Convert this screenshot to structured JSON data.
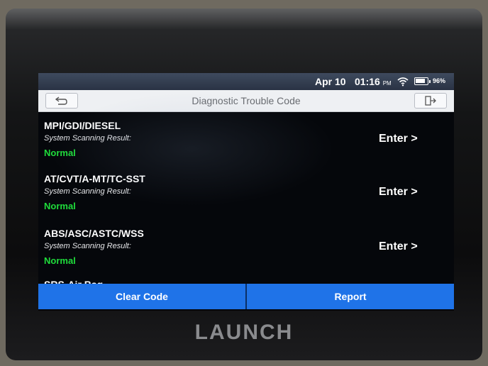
{
  "status_bar": {
    "date": "Apr 10",
    "time": "01:16",
    "ampm": "PM",
    "battery": "96%",
    "battery_level": 0.96
  },
  "header": {
    "title": "Diagnostic Trouble Code"
  },
  "systems": [
    {
      "name": "MPI/GDI/DIESEL",
      "label": "System Scanning Result:",
      "status": "Normal",
      "enter": "Enter >"
    },
    {
      "name": "AT/CVT/A-MT/TC-SST",
      "label": "System Scanning Result:",
      "status": "Normal",
      "enter": "Enter >"
    },
    {
      "name": "ABS/ASC/ASTC/WSS",
      "label": "System Scanning Result:",
      "status": "Normal",
      "enter": "Enter >"
    }
  ],
  "partial_row": {
    "name": "SRS-Air Bag"
  },
  "footer": {
    "clear_code": "Clear Code",
    "report": "Report"
  },
  "device": {
    "brand": "LAUNCH"
  },
  "icons": {
    "back": "back-arrow-icon",
    "exit": "exit-icon",
    "wifi": "wifi-icon",
    "battery": "battery-icon"
  },
  "colors": {
    "status_normal": "#1fdc3b",
    "button_blue": "#1f73e8"
  }
}
